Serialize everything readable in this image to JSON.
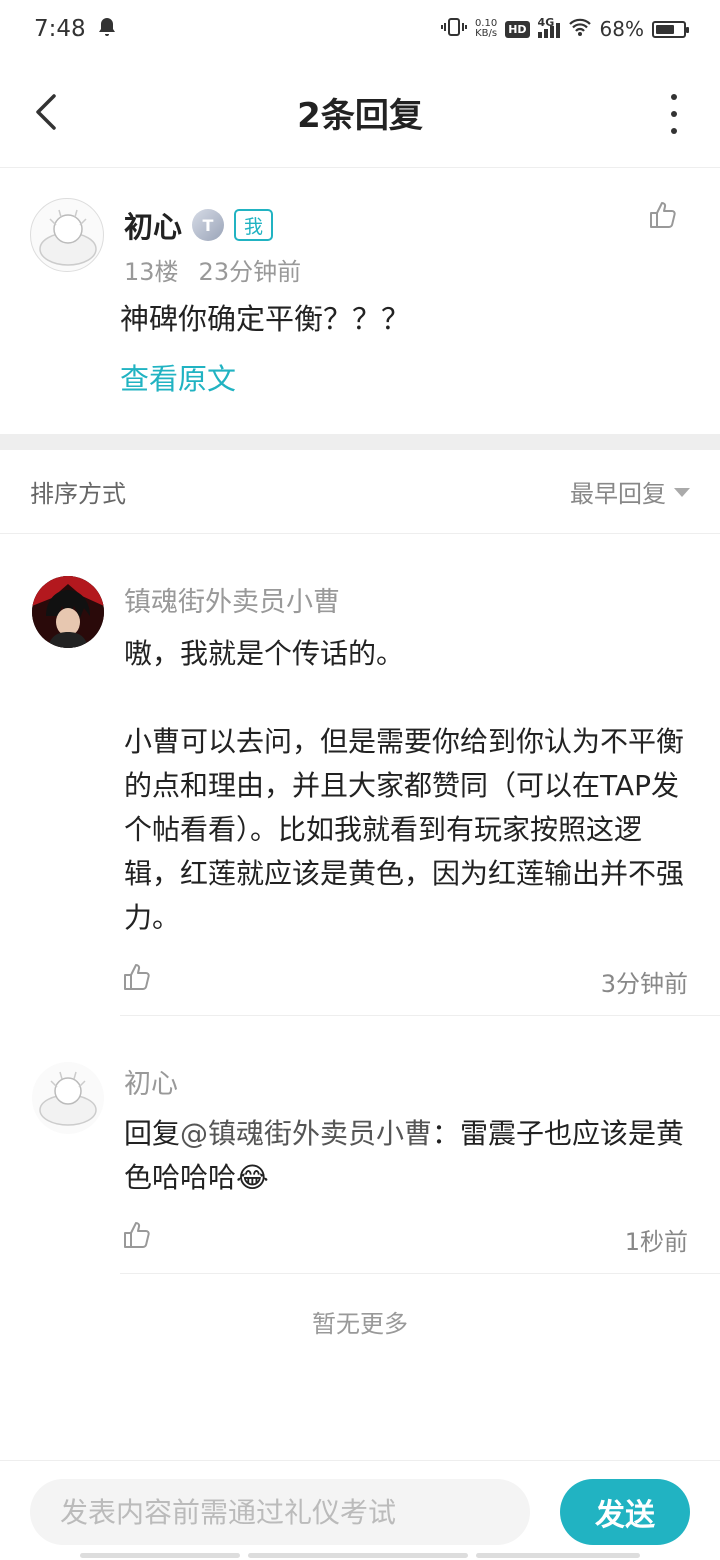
{
  "status_bar": {
    "time": "7:48",
    "net_speed_value": "0.10",
    "net_speed_unit": "KB/s",
    "hd_label": "HD",
    "network": "4G",
    "battery_percent": "68%",
    "battery_level": 0.68
  },
  "header": {
    "title": "2条回复"
  },
  "original_post": {
    "user_name": "初心",
    "level_badge": "T",
    "me_badge": "我",
    "floor": "13楼",
    "time": "23分钟前",
    "text": "神碑你确定平衡？？？",
    "view_original_label": "查看原文"
  },
  "sort": {
    "label": "排序方式",
    "selected": "最早回复"
  },
  "replies": [
    {
      "user_name": "镇魂街外卖员小曹",
      "paragraph_1": "嗷，我就是个传话的。",
      "paragraph_2": "小曹可以去问，但是需要你给到你认为不平衡的点和理由，并且大家都赞同（可以在TAP发个帖看看）。比如我就看到有玩家按照这逻辑，红莲就应该是黄色，因为红莲输出并不强力。",
      "time": "3分钟前"
    },
    {
      "user_name": "初心",
      "reply_prefix": "回复",
      "mention": "@镇魂街外卖员小曹",
      "text": "：雷震子也应该是黄色哈哈哈😂",
      "time": "1秒前"
    }
  ],
  "no_more_label": "暂无更多",
  "composer": {
    "placeholder": "发表内容前需通过礼仪考试",
    "send_label": "发送"
  },
  "colors": {
    "accent": "#21b3c2",
    "divider": "#eeeeee",
    "muted_text": "#999999"
  },
  "icons": [
    "back-arrow-icon",
    "more-vertical-icon",
    "thumbs-up-icon",
    "dropdown-triangle-icon",
    "notification-bell-icon",
    "vibrate-icon",
    "signal-icon",
    "wifi-icon",
    "battery-icon"
  ]
}
